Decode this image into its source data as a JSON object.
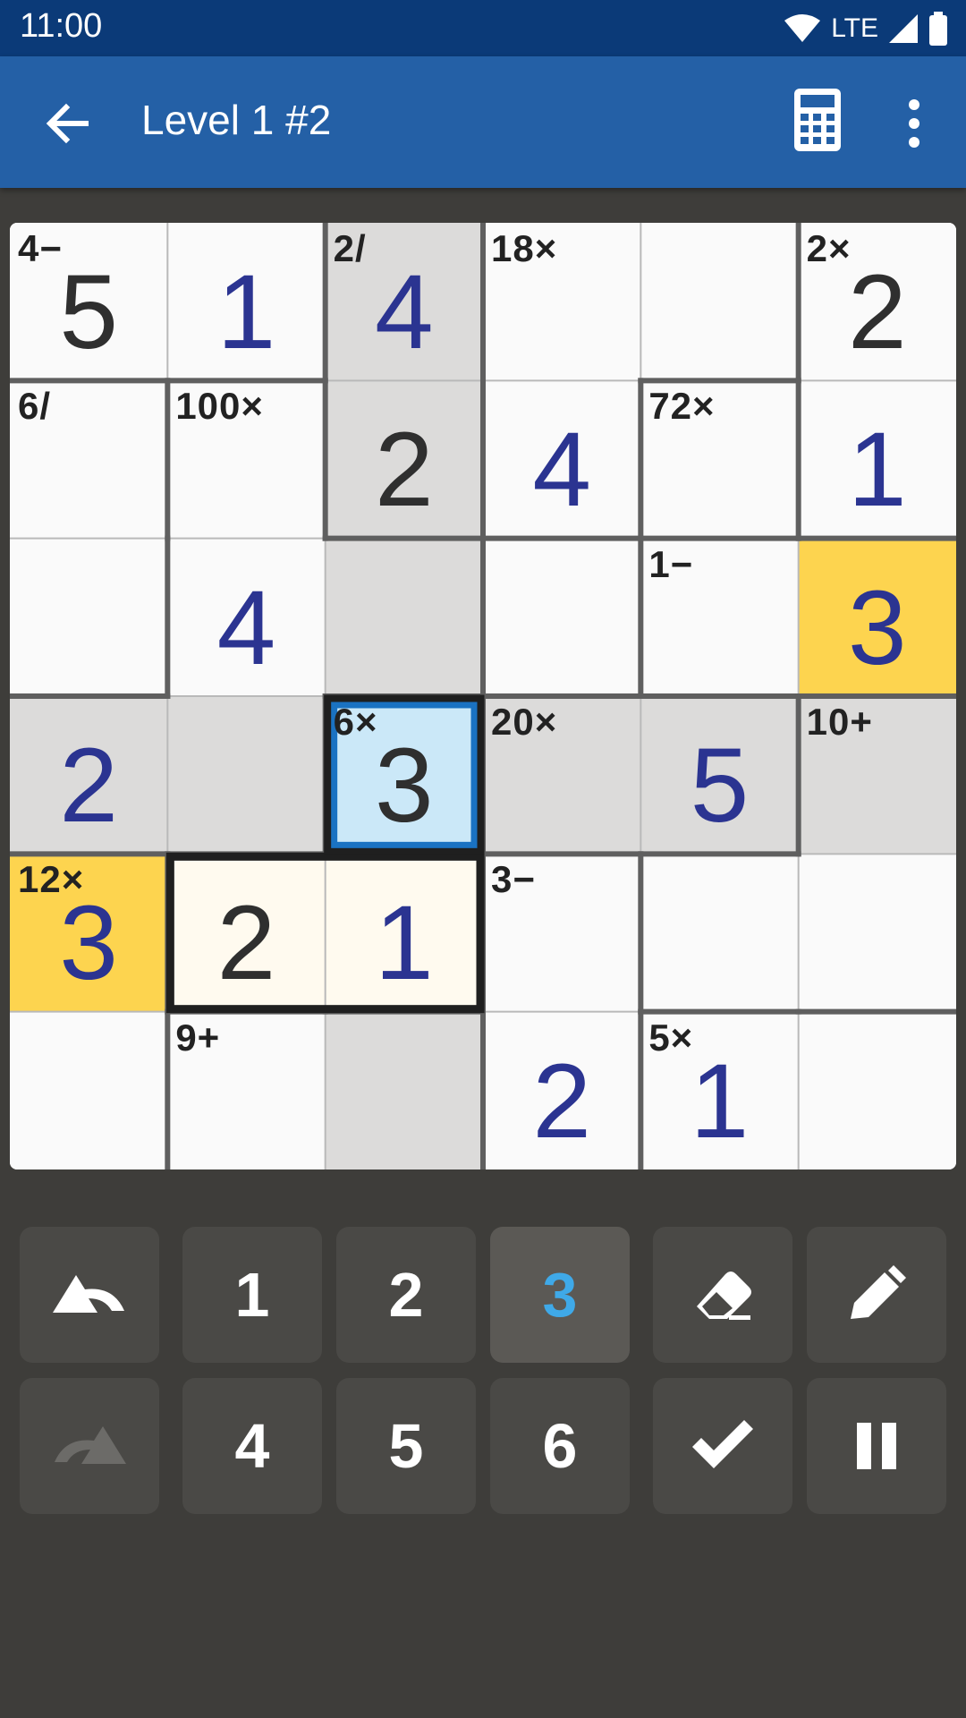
{
  "status_bar": {
    "time": "11:00",
    "network": "LTE"
  },
  "app_bar": {
    "title": "Level 1 #2",
    "icons": [
      "back-arrow-icon",
      "calculator-icon",
      "more-vert-icon"
    ]
  },
  "colors": {
    "cell_white": "#fafafa",
    "cell_gray": "#dcdbda",
    "cell_yellow": "#fdd44f",
    "cell_cream": "#fffaef",
    "cell_selected": "#cbe8f8",
    "selected_border": "#1a72c2",
    "given_digit": "#2f2f2f",
    "entered_digit": "#2b3491",
    "key_bg": "#4a4946",
    "key_selected_bg": "#5b5955",
    "key_selected_text": "#3fa9e8"
  },
  "puzzle": {
    "size": 6,
    "cell_colors": [
      [
        "white",
        "white",
        "gray",
        "white",
        "white",
        "white"
      ],
      [
        "white",
        "white",
        "gray",
        "white",
        "white",
        "white"
      ],
      [
        "white",
        "white",
        "gray",
        "white",
        "white",
        "yellow"
      ],
      [
        "gray",
        "gray",
        "selected",
        "gray",
        "gray",
        "gray"
      ],
      [
        "yellow",
        "cream",
        "cream",
        "white",
        "white",
        "white"
      ],
      [
        "white",
        "white",
        "gray",
        "white",
        "white",
        "white"
      ]
    ],
    "values": [
      [
        "5",
        "1",
        "4",
        "",
        "",
        "2"
      ],
      [
        "",
        "",
        "2",
        "4",
        "",
        "1"
      ],
      [
        "",
        "4",
        "",
        "",
        "",
        "3"
      ],
      [
        "2",
        "",
        "3",
        "",
        "5",
        ""
      ],
      [
        "3",
        "2",
        "1",
        "",
        "",
        ""
      ],
      [
        "",
        "",
        "",
        "2",
        "1",
        ""
      ]
    ],
    "value_styles": [
      [
        "given",
        "entered",
        "entered",
        "",
        "",
        "given"
      ],
      [
        "",
        "",
        "given",
        "entered",
        "",
        "entered"
      ],
      [
        "",
        "entered",
        "",
        "",
        "",
        "entered"
      ],
      [
        "entered",
        "",
        "given",
        "",
        "entered",
        ""
      ],
      [
        "entered",
        "given",
        "entered",
        "",
        "",
        ""
      ],
      [
        "",
        "",
        "",
        "entered",
        "entered",
        ""
      ]
    ],
    "cages": [
      {
        "clue": "4−",
        "cells": [
          [
            0,
            0
          ],
          [
            0,
            1
          ]
        ]
      },
      {
        "clue": "2/",
        "cells": [
          [
            0,
            2
          ],
          [
            1,
            2
          ]
        ]
      },
      {
        "clue": "18×",
        "cells": [
          [
            0,
            3
          ],
          [
            0,
            4
          ],
          [
            1,
            3
          ]
        ]
      },
      {
        "clue": "2×",
        "cells": [
          [
            0,
            5
          ],
          [
            1,
            5
          ]
        ]
      },
      {
        "clue": "6/",
        "cells": [
          [
            1,
            0
          ],
          [
            2,
            0
          ]
        ]
      },
      {
        "clue": "100×",
        "cells": [
          [
            1,
            1
          ],
          [
            2,
            1
          ],
          [
            2,
            2
          ],
          [
            3,
            0
          ],
          [
            3,
            1
          ]
        ]
      },
      {
        "clue": "72×",
        "cells": [
          [
            1,
            4
          ],
          [
            2,
            3
          ],
          [
            1,
            4
          ]
        ]
      },
      {
        "clue": "1−",
        "cells": [
          [
            2,
            4
          ],
          [
            2,
            5
          ]
        ]
      },
      {
        "clue": "6×",
        "cells": [
          [
            3,
            2
          ]
        ]
      },
      {
        "clue": "20×",
        "cells": [
          [
            3,
            3
          ],
          [
            3,
            4
          ]
        ]
      },
      {
        "clue": "10+",
        "cells": [
          [
            3,
            5
          ],
          [
            4,
            4
          ],
          [
            4,
            5
          ]
        ]
      },
      {
        "clue": "12×",
        "cells": [
          [
            4,
            0
          ],
          [
            5,
            0
          ]
        ]
      },
      {
        "clue": "3−",
        "cells": [
          [
            4,
            3
          ],
          [
            5,
            3
          ]
        ]
      },
      {
        "clue": "9+",
        "cells": [
          [
            5,
            1
          ],
          [
            5,
            2
          ]
        ]
      },
      {
        "clue": "5×",
        "cells": [
          [
            5,
            4
          ],
          [
            5,
            5
          ]
        ]
      }
    ]
  },
  "keypad": {
    "keys": [
      {
        "type": "icon",
        "icon": "undo-icon",
        "label": "undo"
      },
      {
        "type": "text",
        "label": "1"
      },
      {
        "type": "text",
        "label": "2"
      },
      {
        "type": "text",
        "label": "3",
        "selected": true
      },
      {
        "type": "icon",
        "icon": "eraser-icon",
        "label": "erase"
      },
      {
        "type": "icon",
        "icon": "pencil-icon",
        "label": "notes"
      },
      {
        "type": "icon",
        "icon": "redo-icon",
        "label": "redo",
        "disabled": true
      },
      {
        "type": "text",
        "label": "4"
      },
      {
        "type": "text",
        "label": "5"
      },
      {
        "type": "text",
        "label": "6"
      },
      {
        "type": "icon",
        "icon": "check-icon",
        "label": "check"
      },
      {
        "type": "icon",
        "icon": "pause-icon",
        "label": "pause"
      }
    ]
  }
}
